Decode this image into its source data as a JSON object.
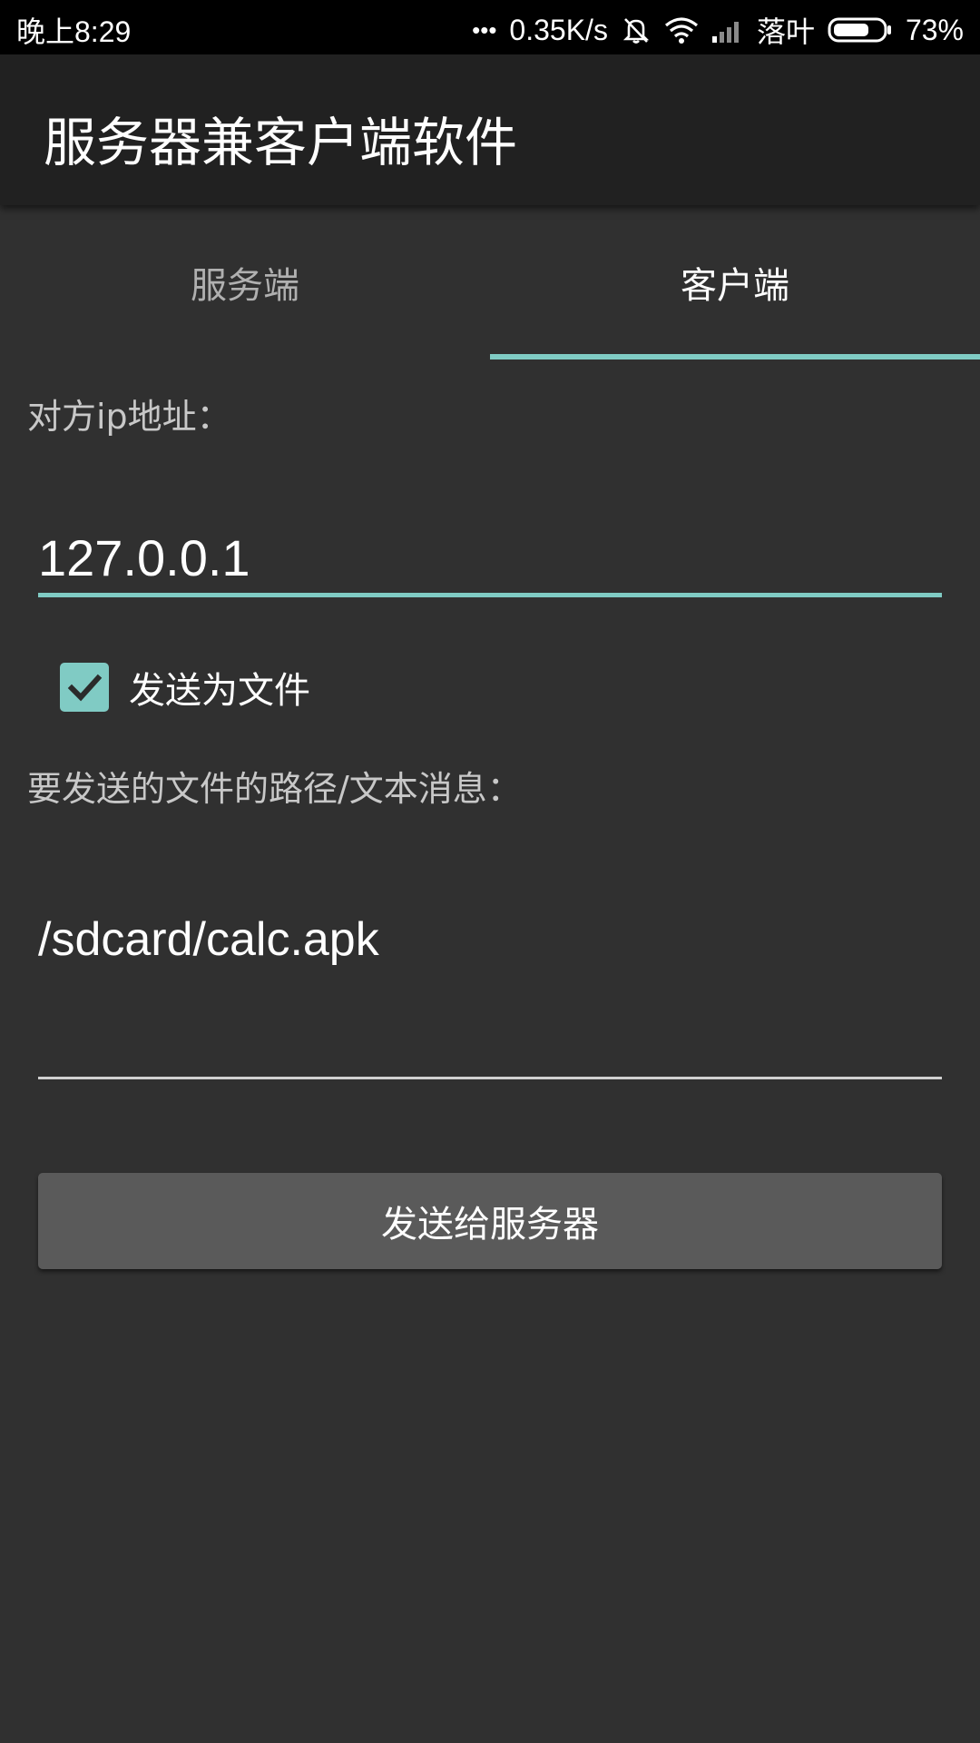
{
  "status_bar": {
    "time": "晚上8:29",
    "dots": "•••",
    "net_speed": "0.35K/s",
    "carrier": "落叶",
    "battery_percent": "73%",
    "battery_level": 0.73,
    "icons": [
      "mute-icon",
      "wifi-icon",
      "signal-icon",
      "battery-icon"
    ]
  },
  "toolbar": {
    "title": "服务器兼客户端软件"
  },
  "tabs": {
    "items": [
      {
        "label": "服务端",
        "active": false
      },
      {
        "label": "客户端",
        "active": true
      }
    ],
    "accent_color": "#80cbc4"
  },
  "client_form": {
    "ip_label": "对方ip地址：",
    "ip_value": "127.0.0.1",
    "send_as_file_label": "发送为文件",
    "send_as_file_checked": true,
    "path_label": "要发送的文件的路径/文本消息：",
    "path_value": "/sdcard/calc.apk",
    "send_button_label": "发送给服务器"
  },
  "colors": {
    "background": "#303030",
    "toolbar": "#212121",
    "accent": "#80cbc4",
    "button": "#5a5a5a"
  }
}
